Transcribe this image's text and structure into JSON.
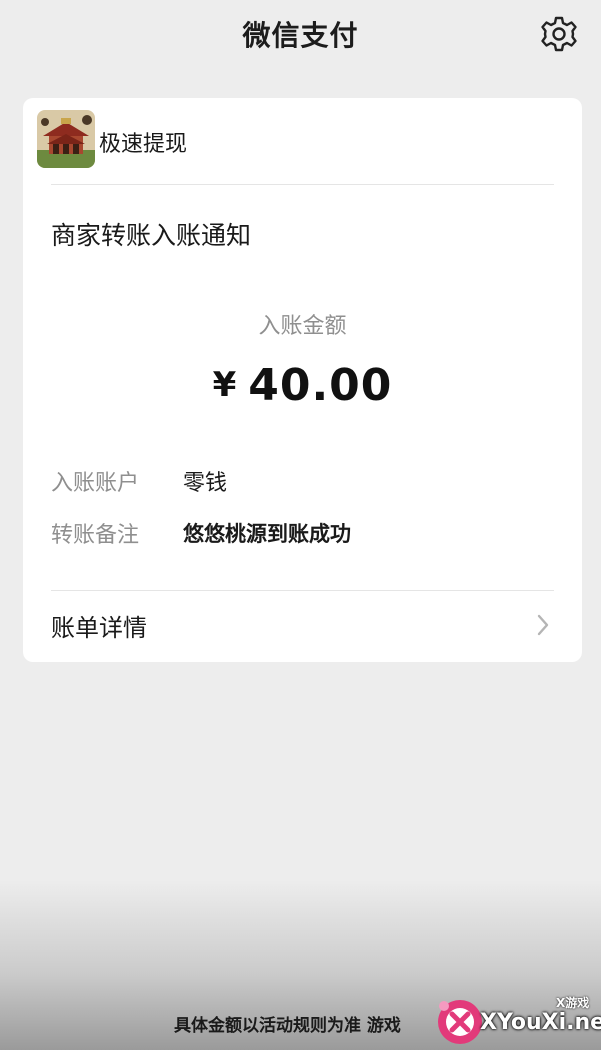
{
  "header": {
    "title": "微信支付",
    "settings_icon": "gear-icon"
  },
  "card": {
    "app_name": "极速提现",
    "app_icon": "app-icon-pagoda",
    "notice_title": "商家转账入账通知",
    "amount_label": "入账金额",
    "currency": "¥",
    "amount": "40.00",
    "rows": [
      {
        "label": "入账账户",
        "value": "零钱"
      },
      {
        "label": "转账备注",
        "value": "悠悠桃源到账成功"
      }
    ],
    "bill_detail_label": "账单详情",
    "bill_detail_icon": "chevron-right-icon"
  },
  "footer": {
    "note": "具体金额以活动规则为准 游戏"
  },
  "watermark": {
    "small": "X游戏",
    "big": "XYouXi.net"
  },
  "colors": {
    "background": "#ededed",
    "card": "#ffffff",
    "muted_text": "#8f8f8f",
    "primary_text": "#1a1a1a"
  }
}
